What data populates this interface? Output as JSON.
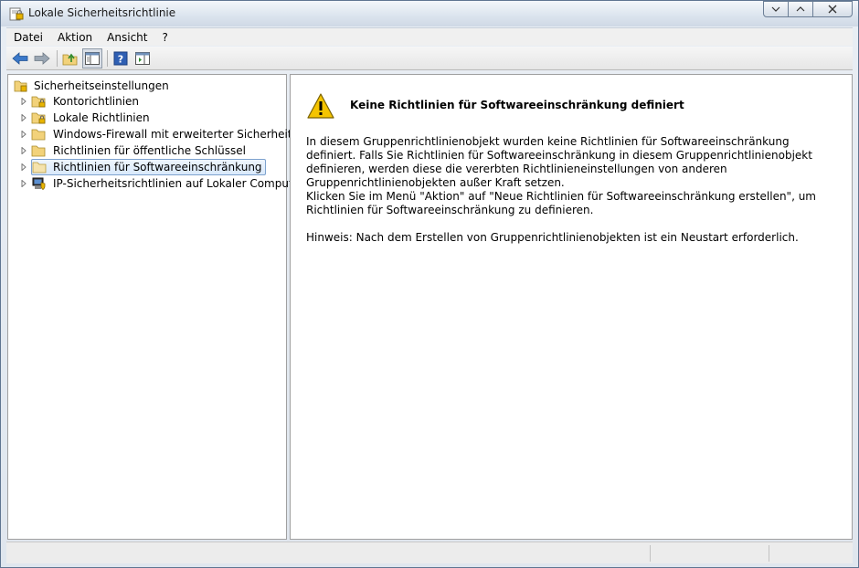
{
  "window": {
    "title": "Lokale Sicherheitsrichtlinie",
    "buttons": {
      "minimize": "_",
      "maximize": "^",
      "close": "x"
    }
  },
  "menubar": {
    "items": [
      "Datei",
      "Aktion",
      "Ansicht",
      "?"
    ]
  },
  "toolbar": {
    "icons": [
      "back-arrow-icon",
      "forward-arrow-icon",
      "up-folder-icon",
      "show-hide-tree-icon",
      "help-icon",
      "show-action-pane-icon"
    ]
  },
  "tree": {
    "root": "Sicherheitseinstellungen",
    "items": [
      {
        "label": "Kontorichtlinien",
        "icon": "locked-folder-icon"
      },
      {
        "label": "Lokale Richtlinien",
        "icon": "locked-folder-icon"
      },
      {
        "label": "Windows-Firewall mit erweiterter Sicherheit",
        "icon": "folder-icon"
      },
      {
        "label": "Richtlinien für öffentliche Schlüssel",
        "icon": "folder-icon"
      },
      {
        "label": "Richtlinien für Softwareeinschränkung",
        "icon": "folder-icon",
        "selected": true
      },
      {
        "label": "IP-Sicherheitsrichtlinien auf Lokaler Computer",
        "icon": "network-shield-icon"
      }
    ]
  },
  "content": {
    "heading": "Keine Richtlinien für Softwareeinschränkung definiert",
    "paragraph1": "In diesem Gruppenrichtlinienobjekt wurden keine Richtlinien für Softwareeinschränkung definiert. Falls Sie Richtlinien für Softwareeinschränkung in diesem Gruppenrichtlinienobjekt definieren, werden diese die vererbten Richtlinieneinstellungen von anderen Gruppenrichtlinienobjekten außer Kraft setzen.",
    "paragraph2": "Klicken Sie im Menü \"Aktion\" auf \"Neue Richtlinien für Softwareeinschränkung erstellen\", um Richtlinien für Softwareeinschränkung zu definieren.",
    "paragraph3": "Hinweis: Nach dem Erstellen von Gruppenrichtlinienobjekten ist ein Neustart erforderlich."
  },
  "colors": {
    "selection_border": "#7da2ce",
    "selection_fill": "#d9e9fb",
    "folder": "#f2d27a",
    "warning": "#f5c400"
  }
}
